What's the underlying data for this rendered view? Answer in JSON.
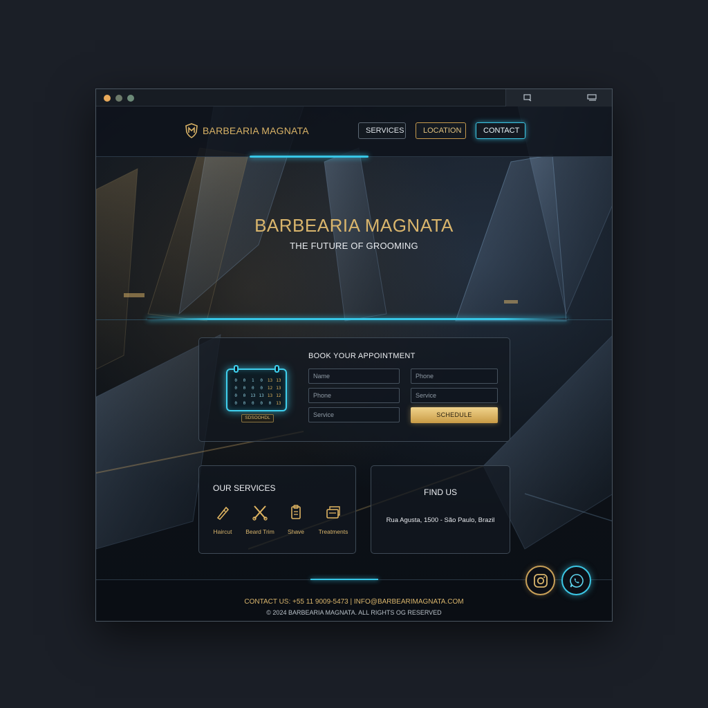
{
  "brand": {
    "name": "BARBEARIA MAGNATA",
    "accent": "#d9b56c",
    "glow": "#37c6e6"
  },
  "nav": {
    "services": "SERVICES",
    "location": "LOCATION",
    "contact": "CONTACT"
  },
  "hero": {
    "title": "BARBEARIA MAGNATA",
    "subtitle": "THE FUTURE OF GROOMING"
  },
  "booking": {
    "title": "BOOK YOUR APPOINTMENT",
    "calendar_label": "SDSOOHDL",
    "fields": {
      "name": "Name",
      "phone_right": "Phone",
      "phone_left": "Phone",
      "service_right": "Service",
      "service_left": "Service"
    },
    "schedule_button": "SCHEDULE",
    "calendar_days": [
      "0",
      "0",
      "1",
      "0",
      "13",
      "13",
      "0",
      "0",
      "0",
      "0",
      "12",
      "13",
      "0",
      "0",
      "13",
      "13",
      "13",
      "12",
      "0",
      "0",
      "0",
      "0",
      "0",
      "13"
    ]
  },
  "services": {
    "title": "OUR SERVICES",
    "items": [
      {
        "label": "Haircut",
        "icon": "razor-icon"
      },
      {
        "label": "Beard Trim",
        "icon": "scissors-icon"
      },
      {
        "label": "Shave",
        "icon": "clipboard-icon"
      },
      {
        "label": "Treatments",
        "icon": "treatments-icon"
      }
    ]
  },
  "findus": {
    "title": "FIND US",
    "address": "Rua Agusta, 1500 - São Paulo, Brazil"
  },
  "footer": {
    "contact": "CONTACT US: +55 11 9009-5473 | INFO@BARBEARIMAGNATA.COM",
    "copyright": "© 2024 BARBEARIA MAGNATA. ALL RIGHTS OG RESERVED"
  },
  "social": {
    "instagram": "instagram-icon",
    "whatsapp": "whatsapp-icon"
  }
}
